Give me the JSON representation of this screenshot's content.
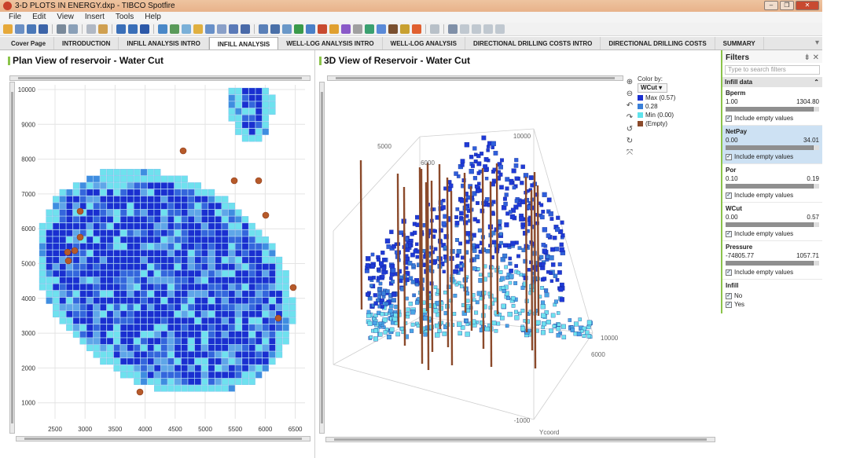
{
  "window": {
    "title": "3-D PLOTS IN ENERGY.dxp - TIBCO Spotfire"
  },
  "menu": [
    "File",
    "Edit",
    "View",
    "Insert",
    "Tools",
    "Help"
  ],
  "tabs": [
    {
      "label": "Cover Page"
    },
    {
      "label": "INTRODUCTION"
    },
    {
      "label": "INFILL ANALYSIS INTRO"
    },
    {
      "label": "INFILL ANALYSIS",
      "active": true
    },
    {
      "label": "WELL-LOG ANALYSIS INTRO"
    },
    {
      "label": "WELL-LOG ANALYSIS"
    },
    {
      "label": "DIRECTIONAL DRILLING COSTS INTRO"
    },
    {
      "label": "DIRECTIONAL DRILLING COSTS"
    },
    {
      "label": "SUMMARY"
    }
  ],
  "plan_view": {
    "title": "Plan View of reservoir - Water Cut",
    "y_ticks": [
      "10000",
      "9000",
      "8000",
      "7000",
      "6000",
      "5000",
      "4000",
      "3000",
      "2000",
      "1000"
    ],
    "x_ticks": [
      "2500",
      "3000",
      "3500",
      "4000",
      "4500",
      "5000",
      "5500",
      "6000",
      "6500"
    ]
  },
  "view3d": {
    "title": "3D View of Reservoir - Water Cut",
    "axis_labels": [
      "5000",
      "10000",
      "6000",
      "10000",
      "6000",
      "-1000",
      "Ycoord"
    ]
  },
  "legend": {
    "label": "Color by:",
    "selected": "WCut",
    "items": [
      {
        "label": "Max (0.57)",
        "color": "#1a2fd0"
      },
      {
        "label": "0.28",
        "color": "#3a7fd8"
      },
      {
        "label": "Min (0.00)",
        "color": "#5ee3ec"
      },
      {
        "label": "(Empty)",
        "color": "#8b4a2b"
      }
    ]
  },
  "filters": {
    "title": "Filters",
    "search_placeholder": "Type to search filters",
    "group": "Infill data",
    "include_label": "Include empty values",
    "sections": [
      {
        "name": "Bperm",
        "min": "1.00",
        "max": "1304.80"
      },
      {
        "name": "NetPay",
        "min": "0.00",
        "max": "34.01"
      },
      {
        "name": "Por",
        "min": "0.10",
        "max": "0.19"
      },
      {
        "name": "WCut",
        "min": "0.00",
        "max": "0.57"
      },
      {
        "name": "Pressure",
        "min": "-74805.77",
        "max": "1057.71"
      }
    ],
    "infill": {
      "name": "Infill",
      "options": [
        "No",
        "Yes"
      ]
    }
  }
}
